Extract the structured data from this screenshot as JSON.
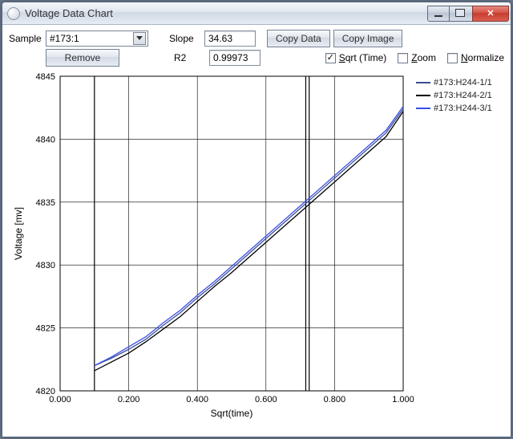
{
  "window": {
    "title": "Voltage Data Chart"
  },
  "toolbar": {
    "sample_label": "Sample",
    "sample_value": "#173:1",
    "slope_label": "Slope",
    "slope_value": "34.63",
    "copy_data": "Copy Data",
    "copy_image": "Copy Image",
    "remove": "Remove",
    "r2_label": "R2",
    "r2_value": "0.99973"
  },
  "checks": {
    "sqrt_time": {
      "label": "Sqrt (Time)",
      "checked": true
    },
    "zoom": {
      "label": "Zoom",
      "checked": false
    },
    "normalize": {
      "label": "Normalize",
      "checked": false
    }
  },
  "chart_data": {
    "type": "line",
    "xlabel": "Sqrt(time)",
    "ylabel": "Voltage [mv]",
    "xlim": [
      0.0,
      1.0
    ],
    "ylim": [
      4820,
      4845
    ],
    "xticks": [
      0.0,
      0.2,
      0.4,
      0.6,
      0.8,
      1.0
    ],
    "yticks": [
      4820,
      4825,
      4830,
      4835,
      4840,
      4845
    ],
    "vlines": [
      0.1,
      0.716,
      0.726
    ],
    "x": [
      0.1,
      0.15,
      0.2,
      0.25,
      0.3,
      0.35,
      0.4,
      0.45,
      0.5,
      0.55,
      0.6,
      0.65,
      0.7,
      0.75,
      0.8,
      0.85,
      0.9,
      0.95,
      1.0
    ],
    "series": [
      {
        "name": "#173:H244-1/1",
        "color": "#3a4e95",
        "values": [
          4822.0,
          4822.6,
          4823.3,
          4824.1,
          4825.2,
          4826.2,
          4827.4,
          4828.5,
          4829.7,
          4830.9,
          4832.1,
          4833.3,
          4834.5,
          4835.7,
          4836.9,
          4838.1,
          4839.3,
          4840.5,
          4842.4
        ]
      },
      {
        "name": "#173:H244-2/1",
        "color": "#000000",
        "values": [
          4821.6,
          4822.3,
          4823.0,
          4823.9,
          4824.9,
          4825.9,
          4827.1,
          4828.3,
          4829.4,
          4830.6,
          4831.8,
          4833.0,
          4834.2,
          4835.4,
          4836.6,
          4837.8,
          4839.0,
          4840.2,
          4842.2
        ]
      },
      {
        "name": "#173:H244-3/1",
        "color": "#3a4ee5",
        "values": [
          4822.0,
          4822.7,
          4823.5,
          4824.3,
          4825.4,
          4826.4,
          4827.6,
          4828.7,
          4829.9,
          4831.1,
          4832.3,
          4833.5,
          4834.7,
          4835.9,
          4837.1,
          4838.3,
          4839.5,
          4840.7,
          4842.6
        ]
      }
    ]
  }
}
